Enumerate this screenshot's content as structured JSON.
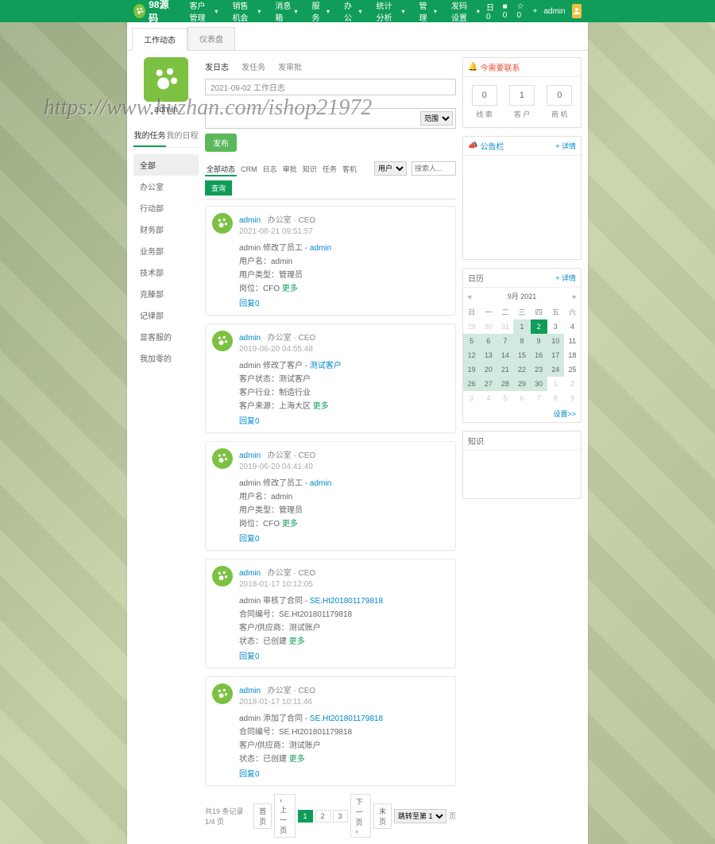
{
  "topbar": {
    "logo_text": "98源码",
    "nav": [
      "客户管理",
      "销售机会",
      "消息箱",
      "服 务",
      "办 公",
      "统计分析",
      "管 理",
      "发码设置"
    ],
    "right_items": [
      "日 0",
      "■ 0",
      "☆ 0",
      "+"
    ],
    "user": "admin"
  },
  "page_tabs": {
    "active": "工作动态",
    "inactive": "仪表盘"
  },
  "user_block": {
    "name": "admin"
  },
  "left_switch": {
    "tasks": "我的任务",
    "schedule": "我的日程"
  },
  "departments": [
    "全部",
    "办公室",
    "行动部",
    "财务部",
    "业务部",
    "技术部",
    "克滕部",
    "记律部",
    "显客服的",
    "我加零的"
  ],
  "post": {
    "tabs": [
      "发日志",
      "发任务",
      "发审批"
    ],
    "subject_placeholder": "2021-09-02 工作日志",
    "range_label": "范围",
    "publish": "发布"
  },
  "filter": {
    "tabs": [
      "全部动态",
      "CRM",
      "日志",
      "审批",
      "知识",
      "任务",
      "客机"
    ],
    "role_label": "用户",
    "search_placeholder": "搜索人...",
    "btn": "查询"
  },
  "feed": [
    {
      "user": "admin",
      "meta": "办公室 · CEO",
      "time": "2021-08-21 09:51:57",
      "lines": [
        {
          "t": "admin 修改了员工 - ",
          "link": "admin"
        },
        {
          "t": "用户名：admin"
        },
        {
          "t": "用户类型：管理员"
        },
        {
          "t": "岗位：CFO ",
          "more": "更多"
        }
      ]
    },
    {
      "user": "admin",
      "meta": "办公室 · CEO",
      "time": "2019-06-20 04:55:48",
      "lines": [
        {
          "t": "admin 修改了客户 - ",
          "link": "测试客户"
        },
        {
          "t": "客户状态：测试客户"
        },
        {
          "t": "客户行业：制造行业"
        },
        {
          "t": "客户来源：上海大区 ",
          "more": "更多"
        }
      ]
    },
    {
      "user": "admin",
      "meta": "办公室 · CEO",
      "time": "2019-06-20 04:41:40",
      "lines": [
        {
          "t": "admin 修改了员工 - ",
          "link": "admin"
        },
        {
          "t": "用户名：admin"
        },
        {
          "t": "用户类型：管理员"
        },
        {
          "t": "岗位：CFO ",
          "more": "更多"
        }
      ]
    },
    {
      "user": "admin",
      "meta": "办公室 · CEO",
      "time": "2018-01-17 10:12:05",
      "lines": [
        {
          "t": "admin 审核了合同 - ",
          "link": "SE.Ht201801179818"
        },
        {
          "t": "合同编号：SE.Ht201801179818"
        },
        {
          "t": "客户/供应商：测试账户"
        },
        {
          "t": "状态：已创建 ",
          "more": "更多"
        }
      ]
    },
    {
      "user": "admin",
      "meta": "办公室 · CEO",
      "time": "2018-01-17 10:11:46",
      "lines": [
        {
          "t": "admin 添加了合同 - ",
          "link": "SE.Ht201801179818"
        },
        {
          "t": "合同编号：SE.Ht201801179818"
        },
        {
          "t": "客户/供应商：测试账户"
        },
        {
          "t": "状态：已创建 ",
          "more": "更多"
        }
      ]
    }
  ],
  "feed_reply": "回复0",
  "pager": {
    "summary": "共19 条记录 1/4 页",
    "first": "首页",
    "prev": "‹ 上一页",
    "pages": [
      "1",
      "2",
      "3"
    ],
    "next": "下一页 ›",
    "last": "末页",
    "jump_suffix": "页",
    "jump_label": "跳转至第 1"
  },
  "contacts": {
    "title": "今需要联系",
    "kpi": [
      {
        "n": "0",
        "l": "线 索"
      },
      {
        "n": "1",
        "l": "客 户"
      },
      {
        "n": "0",
        "l": "商 机"
      }
    ]
  },
  "announce": {
    "title": "公告栏",
    "tools": "+ 详情"
  },
  "calendar": {
    "title": "日历",
    "tools": "+ 详情",
    "month": "9月 2021",
    "dow": [
      "日",
      "一",
      "二",
      "三",
      "四",
      "五",
      "六"
    ],
    "rows": [
      [
        {
          "d": 29,
          "m": 1
        },
        {
          "d": 30,
          "m": 1
        },
        {
          "d": 31,
          "m": 1
        },
        {
          "d": 1,
          "h": 1
        },
        {
          "d": 2,
          "s": 1
        },
        {
          "d": 3
        },
        {
          "d": 4
        }
      ],
      [
        {
          "d": 5,
          "h": 1
        },
        {
          "d": 6,
          "h": 1
        },
        {
          "d": 7,
          "h": 1
        },
        {
          "d": 8,
          "h": 1
        },
        {
          "d": 9,
          "h": 1
        },
        {
          "d": 10,
          "h": 1
        },
        {
          "d": 11
        }
      ],
      [
        {
          "d": 12,
          "h": 1
        },
        {
          "d": 13,
          "h": 1
        },
        {
          "d": 14,
          "h": 1
        },
        {
          "d": 15,
          "h": 1
        },
        {
          "d": 16,
          "h": 1
        },
        {
          "d": 17,
          "h": 1
        },
        {
          "d": 18
        }
      ],
      [
        {
          "d": 19,
          "h": 1
        },
        {
          "d": 20,
          "h": 1
        },
        {
          "d": 21,
          "h": 1
        },
        {
          "d": 22,
          "h": 1
        },
        {
          "d": 23,
          "h": 1
        },
        {
          "d": 24,
          "h": 1
        },
        {
          "d": 25
        }
      ],
      [
        {
          "d": 26,
          "h": 1
        },
        {
          "d": 27,
          "h": 1
        },
        {
          "d": 28,
          "h": 1
        },
        {
          "d": 29,
          "h": 1
        },
        {
          "d": 30,
          "h": 1
        },
        {
          "d": 1,
          "m": 1
        },
        {
          "d": 2,
          "m": 1
        }
      ],
      [
        {
          "d": 3,
          "m": 1
        },
        {
          "d": 4,
          "m": 1
        },
        {
          "d": 5,
          "m": 1
        },
        {
          "d": 6,
          "m": 1
        },
        {
          "d": 7,
          "m": 1
        },
        {
          "d": 8,
          "m": 1
        },
        {
          "d": 9,
          "m": 1
        }
      ]
    ],
    "today_link": "设置>>"
  },
  "knowledge": {
    "title": "知识"
  }
}
